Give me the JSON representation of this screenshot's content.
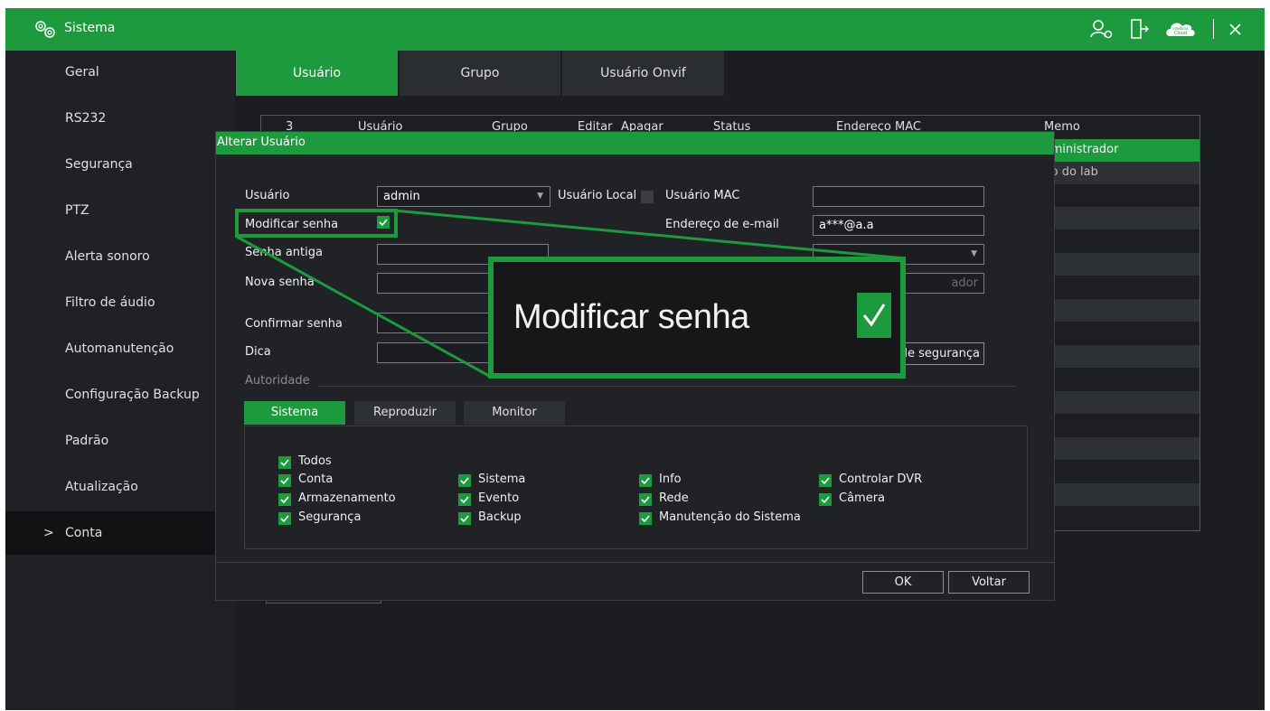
{
  "app": {
    "title": "Sistema"
  },
  "header_icons": [
    "user-settings-icon",
    "logout-icon",
    "cloud-icon",
    "close-icon"
  ],
  "header_cloud_text": {
    "line1": "intelbras",
    "line2": "Cloud"
  },
  "sidebar": {
    "items": [
      {
        "label": "Geral"
      },
      {
        "label": "RS232"
      },
      {
        "label": "Segurança"
      },
      {
        "label": "PTZ"
      },
      {
        "label": "Alerta sonoro"
      },
      {
        "label": "Filtro de áudio"
      },
      {
        "label": "Automanutenção"
      },
      {
        "label": "Configuração Backup"
      },
      {
        "label": "Padrão"
      },
      {
        "label": "Atualização"
      },
      {
        "label": "Conta",
        "chevron": ">",
        "active": true
      }
    ]
  },
  "tabs": [
    {
      "label": "Usuário",
      "active": true
    },
    {
      "label": "Grupo"
    },
    {
      "label": "Usuário Onvif"
    }
  ],
  "user_table": {
    "headers": [
      "3",
      "Usuário",
      "Grupo",
      "Editar",
      "Apagar",
      "Status",
      "Endereço MAC",
      "Memo"
    ],
    "visible_memo": [
      "lministrador",
      "io do lab"
    ]
  },
  "dialog": {
    "title": "Alterar Usuário",
    "usuario_label": "Usuário",
    "usuario_value": "admin",
    "usuario_local_label": "Usuário Local",
    "usuario_mac_label": "Usuário MAC",
    "modificar_senha_label": "Modificar senha",
    "email_label": "Endereço de e-mail",
    "email_value": "a***@a.a",
    "senha_antiga_label": "Senha antiga",
    "nova_senha_label": "Nova senha",
    "confirmar_senha_label": "Confirmar senha",
    "dica_label": "Dica",
    "autoridade_label": "Autoridade",
    "partial_right_field": "ador",
    "partial_security_button": "le segurança",
    "subtabs": [
      {
        "label": "Sistema",
        "active": true
      },
      {
        "label": "Reproduzir"
      },
      {
        "label": "Monitor"
      }
    ],
    "permissions": {
      "todos": "Todos",
      "col1": [
        "Conta",
        "Armazenamento",
        "Segurança"
      ],
      "col2": [
        "Sistema",
        "Evento",
        "Backup"
      ],
      "col3": [
        "Info",
        "Rede",
        "Manutenção do Sistema"
      ],
      "col4": [
        "Controlar DVR",
        "Câmera"
      ]
    },
    "ok_label": "OK",
    "voltar_label": "Voltar"
  },
  "zoom_callout": {
    "text": "Modificar senha"
  },
  "colors": {
    "accent": "#1e9a3e",
    "background": "#1b1d20",
    "sidebar": "#1f2124"
  }
}
